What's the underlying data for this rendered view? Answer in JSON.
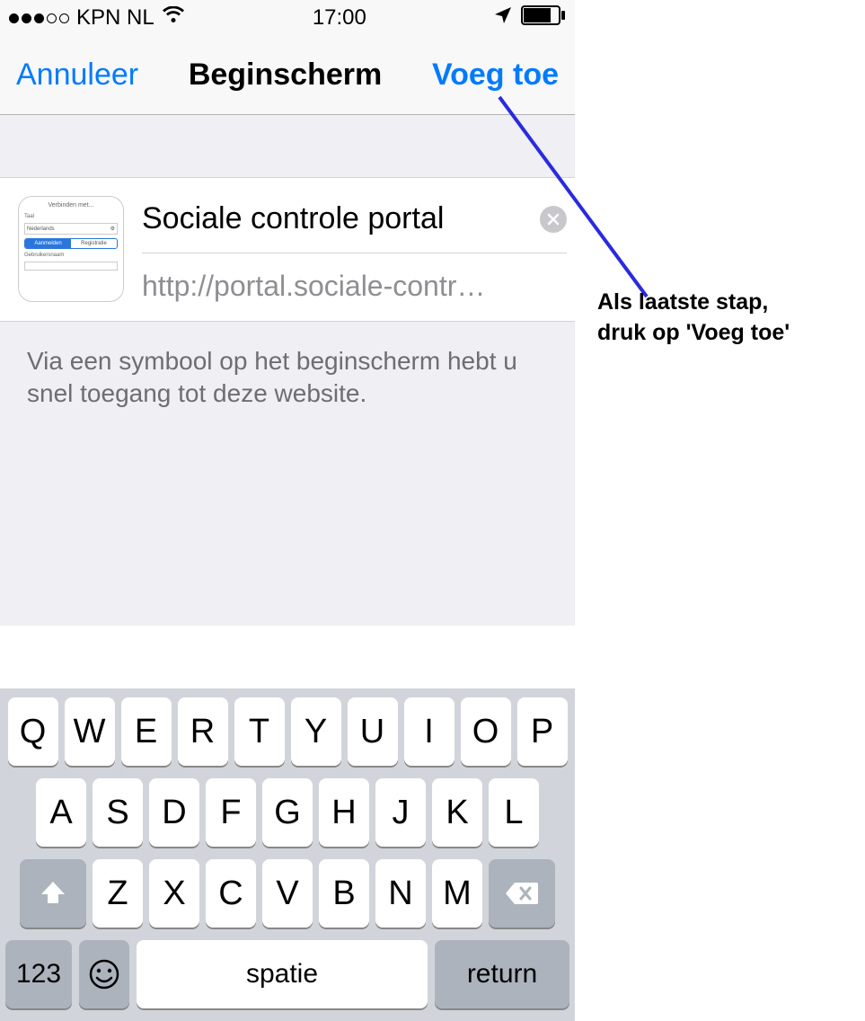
{
  "status": {
    "carrier": "KPN NL",
    "time": "17:00"
  },
  "nav": {
    "cancel": "Annuleer",
    "title": "Beginscherm",
    "add": "Voeg toe"
  },
  "card": {
    "title_value": "Sociale controle portal",
    "url": "http://portal.sociale-contr…",
    "thumb": {
      "heading": "Verbinden met...",
      "label_lang": "Taal",
      "lang_value": "Nederlands",
      "tab_login": "Aanmelden",
      "tab_register": "Registratie",
      "field_user": "Gebruikersnaam"
    }
  },
  "description": "Via een symbool op het beginscherm hebt u snel toegang tot deze website.",
  "keyboard": {
    "row1": [
      "Q",
      "W",
      "E",
      "R",
      "T",
      "Y",
      "U",
      "I",
      "O",
      "P"
    ],
    "row2": [
      "A",
      "S",
      "D",
      "F",
      "G",
      "H",
      "J",
      "K",
      "L"
    ],
    "row3": [
      "Z",
      "X",
      "C",
      "V",
      "B",
      "N",
      "M"
    ],
    "numKey": "123",
    "space": "spatie",
    "return": "return"
  },
  "annotation": {
    "line1": "Als laatste stap,",
    "line2": "druk op 'Voeg toe'"
  }
}
